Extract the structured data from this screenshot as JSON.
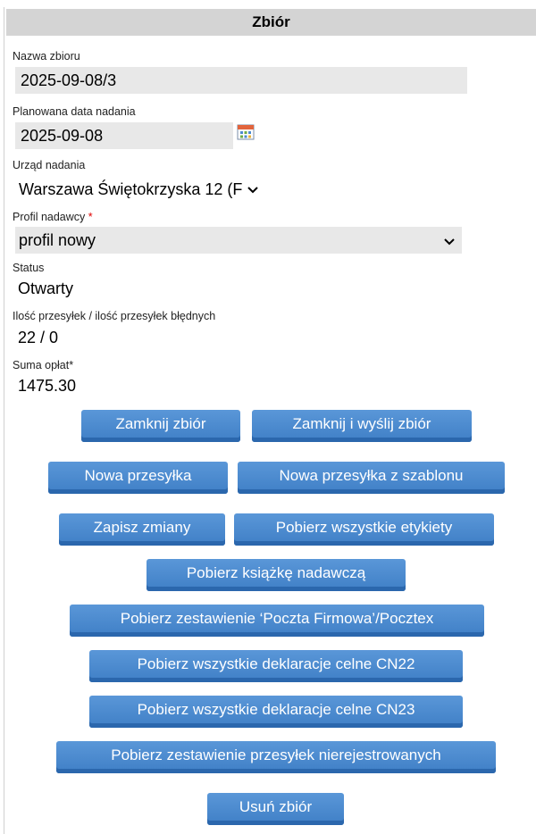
{
  "header": {
    "title": "Zbiór"
  },
  "fields": {
    "name": {
      "label": "Nazwa zbioru",
      "value": "2025-09-08/3"
    },
    "planned_date": {
      "label": "Planowana data nadania",
      "value": "2025-09-08"
    },
    "office": {
      "label": "Urząd nadania",
      "value": "Warszawa Świętokrzyska 12 (F"
    },
    "profile": {
      "label": "Profil nadawcy",
      "required_mark": "*",
      "value": "profil nowy"
    },
    "status": {
      "label": "Status",
      "value": "Otwarty"
    },
    "count": {
      "label": "Ilość przesyłek / ilość przesyłek błędnych",
      "value": "22 / 0"
    },
    "fees": {
      "label": "Suma opłat*",
      "value": "1475.30"
    }
  },
  "buttons": {
    "close": "Zamknij zbiór",
    "close_send": "Zamknij i wyślij zbiór",
    "new_shipment": "Nowa przesyłka",
    "new_from_template": "Nowa przesyłka z szablonu",
    "save": "Zapisz zmiany",
    "get_labels": "Pobierz wszystkie etykiety",
    "get_book": "Pobierz książkę nadawczą",
    "get_summary_pf": "Pobierz zestawienie ‘Poczta Firmowa’/Pocztex",
    "get_cn22": "Pobierz wszystkie deklaracje celne CN22",
    "get_cn23": "Pobierz wszystkie deklaracje celne CN23",
    "get_unregistered": "Pobierz zestawienie przesyłek nierejestrowanych",
    "delete": "Usuń zbiór"
  },
  "icons": {
    "calendar": "calendar-icon",
    "chevron": "chevron-down-icon"
  },
  "colors": {
    "button": "#4a88cc",
    "header_bg": "#d4d4d4",
    "field_bg": "#e8e8e8",
    "required": "#e00000"
  }
}
